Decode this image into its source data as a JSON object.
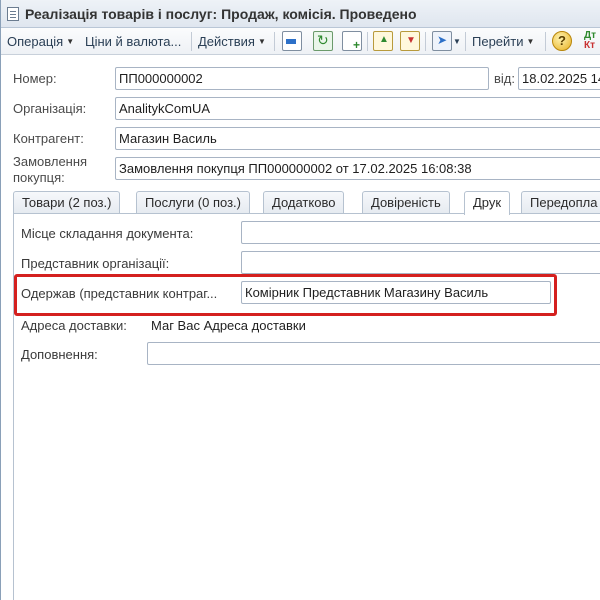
{
  "window": {
    "title": "Реалізація товарів і послуг: Продаж, комісія. Проведено"
  },
  "toolbar": {
    "operation_label": "Операція",
    "prices_label": "Ціни й валюта...",
    "actions_label": "Действия",
    "goto_label": "Перейти",
    "help_label": "?",
    "dt_label_top": "Дт",
    "dt_label_bottom": "Кт"
  },
  "header": {
    "number_label": "Номер:",
    "number_value": "ПП000000002",
    "date_label": "від:",
    "date_value": "18.02.2025 14",
    "org_label": "Організація:",
    "org_value": "AnalitykComUA",
    "counterparty_label": "Контрагент:",
    "counterparty_value": "Магазин Василь",
    "order_label_line1": "Замовлення",
    "order_label_line2": "покупця:",
    "order_value": "Замовлення покупця ПП000000002 от 17.02.2025 16:08:38"
  },
  "tabs": [
    {
      "label": "Товари (2 поз.)"
    },
    {
      "label": "Послуги (0 поз.)"
    },
    {
      "label": "Додатково"
    },
    {
      "label": "Довіреність"
    },
    {
      "label": "Друк"
    },
    {
      "label": "Передопла"
    }
  ],
  "print_tab": {
    "place_label": "Місце складання документа:",
    "place_value": "",
    "org_rep_label": "Представник організації:",
    "org_rep_value": "",
    "receiver_label": "Одержав (представник контраг...",
    "receiver_value": "Комірник Представник Магазину Василь",
    "delivery_label": "Адреса доставки:",
    "delivery_value": "Маг Вас Адреса доставки",
    "addition_label": "Доповнення:",
    "addition_value": ""
  },
  "colors": {
    "highlight": "#d4201f"
  }
}
